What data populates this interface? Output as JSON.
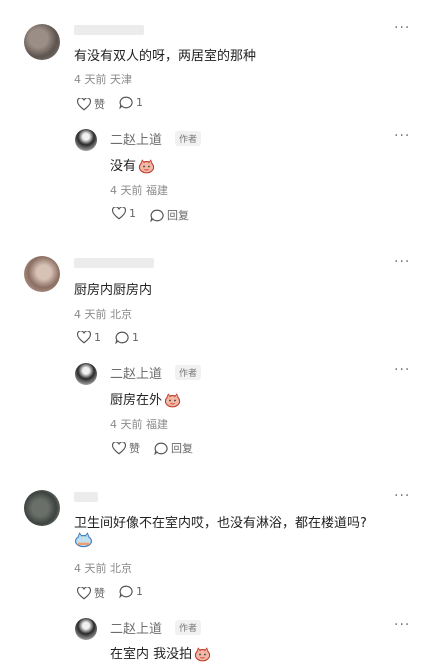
{
  "icons": {
    "more": "more-dots-icon",
    "like": "heart-icon",
    "reply": "speech-bubble-icon",
    "emoji": "cat-face-emoji-icon"
  },
  "colors": {
    "accent_reply_text": "#555555",
    "meta": "#8a8a8a"
  },
  "comments": [
    {
      "text": "有没有双人的呀，两居室的那种",
      "time": "4 天前",
      "location": "天津",
      "like_label": "赞",
      "reply_count": "1",
      "reply": {
        "author": "二赵上道",
        "badge": "作者",
        "text": "没有",
        "time": "4 天前",
        "location": "福建",
        "like_count": "1",
        "reply_label": "回复"
      }
    },
    {
      "text": "厨房内厨房内",
      "time": "4 天前",
      "location": "北京",
      "like_count": "1",
      "reply_count": "1",
      "reply": {
        "author": "二赵上道",
        "badge": "作者",
        "text": "厨房在外",
        "time": "4 天前",
        "location": "福建",
        "like_label": "赞",
        "reply_label": "回复"
      }
    },
    {
      "text": "卫生间好像不在室内哎，也没有淋浴，都在楼道吗?",
      "time": "4 天前",
      "location": "北京",
      "like_label": "赞",
      "reply_count": "1",
      "reply": {
        "author": "二赵上道",
        "badge": "作者",
        "text": "在室内 我没拍"
      }
    }
  ]
}
